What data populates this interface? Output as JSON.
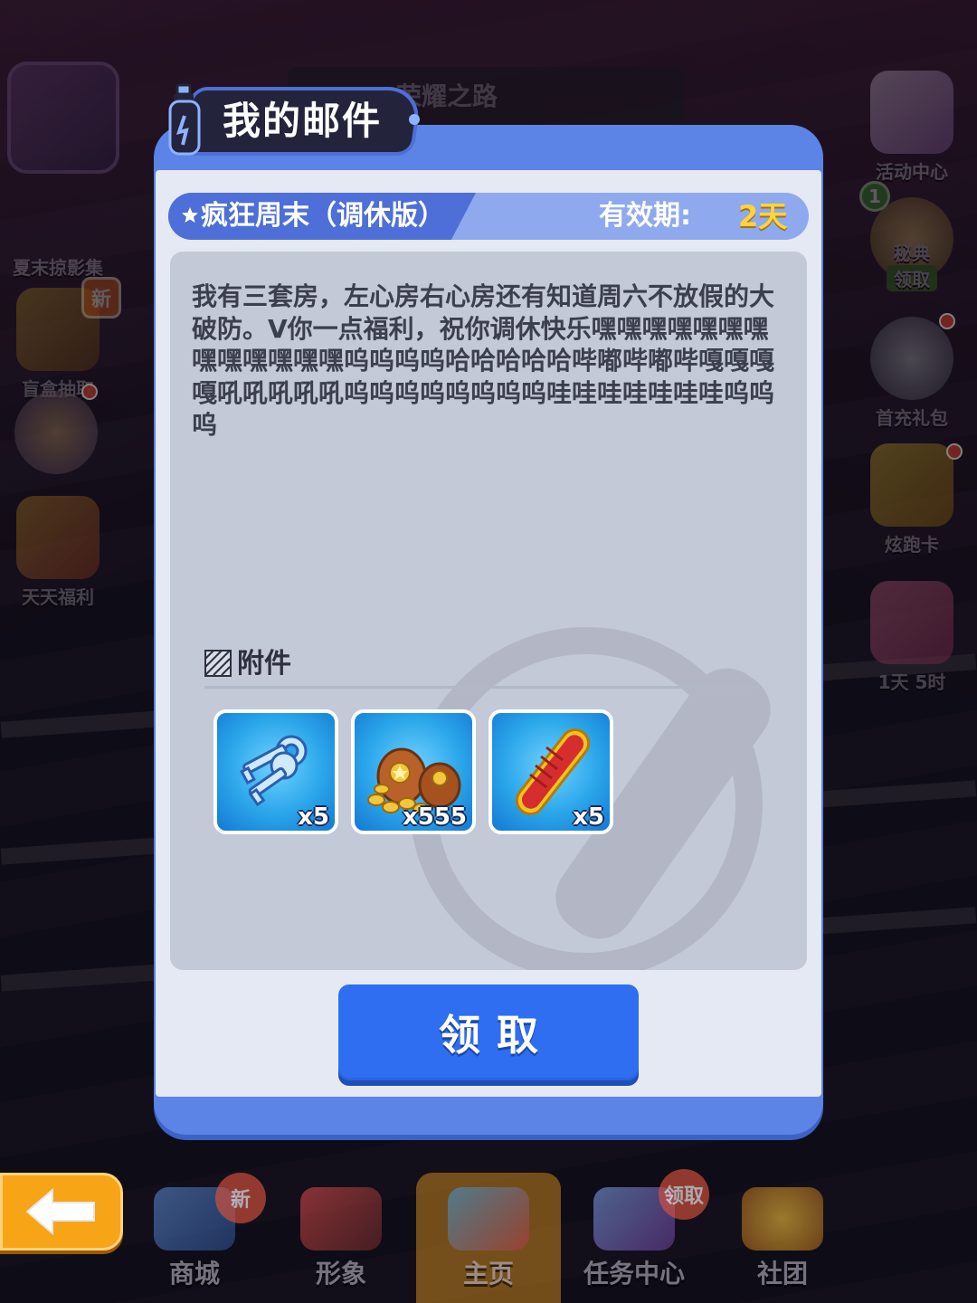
{
  "background": {
    "road_title": "荣耀之路",
    "left_items": [
      {
        "label": "夏末掠影集",
        "icon": "album-icon"
      },
      {
        "label": "盲盒抽取",
        "icon": "blind-box-icon",
        "badge": "新"
      },
      {
        "label": "",
        "icon": "character-icon"
      },
      {
        "label": "天天福利",
        "icon": "daily-gift-icon"
      }
    ],
    "right_items": [
      {
        "label": "活动中心",
        "icon": "calendar-icon"
      },
      {
        "label": "秘典",
        "sub": "领取",
        "icon": "spade-icon",
        "counter": "1"
      },
      {
        "label": "首充礼包",
        "icon": "bunny-icon"
      },
      {
        "label": "炫跑卡",
        "icon": "card-icon"
      },
      {
        "label": "1天 5时",
        "icon": "gift-box-icon"
      }
    ],
    "nav": [
      {
        "label": "商城",
        "badge": "新"
      },
      {
        "label": "形象"
      },
      {
        "label": "主页"
      },
      {
        "label": "任务中心",
        "badge": "领取"
      },
      {
        "label": "社团"
      }
    ]
  },
  "dialog": {
    "title": "我的邮件",
    "mail": {
      "subject": "疯狂周末（调休版）",
      "validity_label": "有效期:",
      "validity_value": "2天",
      "body": "我有三套房，左心房右心房还有知道周六不放假的大破防。V你一点福利，祝你调休快乐嘿嘿嘿嘿嘿嘿嘿嘿嘿嘿嘿嘿嘿呜呜呜呜哈哈哈哈哈哔嘟哔嘟哔嘎嘎嘎嘎吼吼吼吼吼呜呜呜呜呜呜呜呜哇哇哇哇哇哇哇呜呜呜"
    },
    "attachments_label": "附件",
    "attachments": [
      {
        "name": "keys",
        "icon": "keys-icon",
        "qty": "x5"
      },
      {
        "name": "coins",
        "icon": "coin-bags-icon",
        "qty": "x555"
      },
      {
        "name": "hoverboard",
        "icon": "hoverboard-icon",
        "qty": "x5"
      }
    ],
    "claim_label": "领取"
  },
  "colors": {
    "dialog_frame": "#5b84e6",
    "header_dark": "#4d6fd7",
    "validity_gold": "#ffd43b",
    "claim_button": "#2f6ef0",
    "back_button": "#f7a417"
  }
}
